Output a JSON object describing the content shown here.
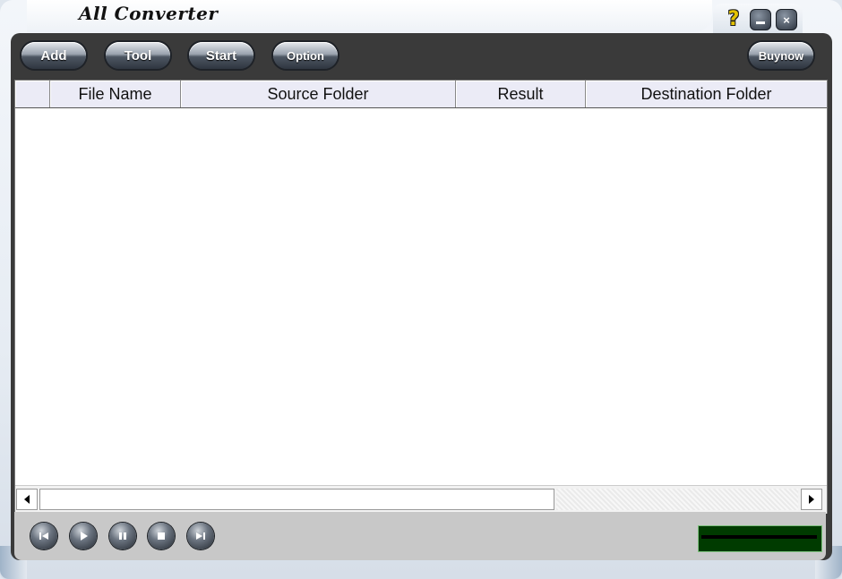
{
  "window": {
    "title": "All Converter",
    "help_symbol": "?",
    "close_symbol": "×"
  },
  "toolbar": {
    "add_label": "Add",
    "tool_label": "Tool",
    "start_label": "Start",
    "option_label": "Option",
    "buynow_label": "Buynow"
  },
  "table": {
    "columns": [
      "",
      "File Name",
      "Source Folder",
      "Result",
      "Destination Folder"
    ],
    "rows": []
  },
  "player": {
    "controls": [
      "previous-icon",
      "play-icon",
      "pause-icon",
      "stop-icon",
      "next-icon"
    ]
  },
  "colors": {
    "panel": "#3a3a3a",
    "header_bg": "#ebebf6",
    "level_meter": "#003b00",
    "help_icon": "#e3c200"
  }
}
